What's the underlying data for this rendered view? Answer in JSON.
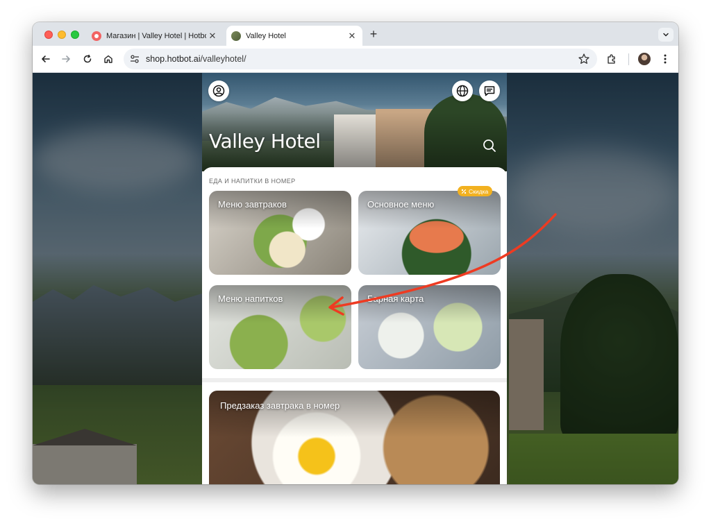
{
  "browser": {
    "tabs": [
      {
        "title": "Магазин | Valley Hotel | Hotbot",
        "active": false,
        "favicon": "hotbot-favicon"
      },
      {
        "title": "Valley Hotel",
        "active": true,
        "favicon": "valley-hotel-favicon"
      }
    ],
    "new_tab_label": "+",
    "close_label": "✕",
    "url": {
      "host": "shop.hotbot.ai",
      "path": "/valleyhotel/"
    }
  },
  "app": {
    "hotel_name": "Valley Hotel",
    "section_label": "ЕДА И НАПИТКИ В НОМЕР",
    "cards": [
      {
        "label": "Меню завтраков"
      },
      {
        "label": "Основное меню",
        "badge": "Скидка"
      },
      {
        "label": "Меню напитков"
      },
      {
        "label": "Барная карта"
      }
    ],
    "preorder_card": {
      "label": "Предзаказ завтрака в номер"
    }
  },
  "colors": {
    "badge": "#f2b120",
    "annotation_arrow": "#ee3b22"
  }
}
